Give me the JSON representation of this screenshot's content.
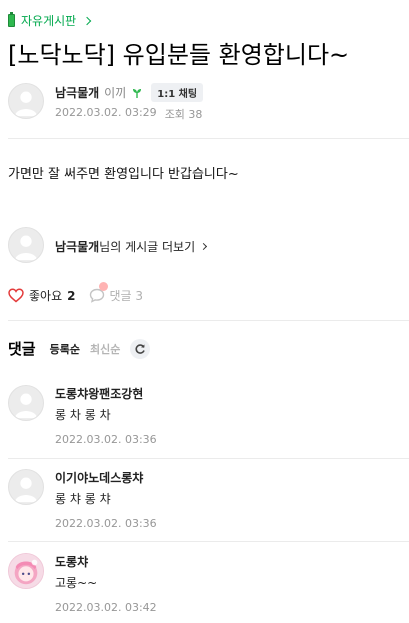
{
  "board": {
    "label": "자유게시판"
  },
  "post": {
    "title": "[노닥노닥] 유입분들 환영합니다~",
    "author": "남극물개",
    "level": "이끼",
    "chat_label": "1:1 채팅",
    "date": "2022.03.02. 03:29",
    "views": "조회 38",
    "body": "가면만 잘 써주면 환영입니다 반갑습니다~"
  },
  "more_posts": {
    "author": "남극물개",
    "suffix": "님의 게시글 더보기"
  },
  "reactions": {
    "like_label": "좋아요",
    "like_count": "2",
    "comment_label": "댓글 3"
  },
  "comments_section": {
    "title": "댓글",
    "sort_options": [
      "등록순",
      "최신순"
    ],
    "items": [
      {
        "author": "도롱챠왕팬조강현",
        "text": "롱 차 롱 차",
        "date": "2022.03.02. 03:36"
      },
      {
        "author": "이기야노데스롱챠",
        "text": "롱 챠 롱 챠",
        "date": "2022.03.02. 03:36"
      },
      {
        "author": "도롱챠",
        "text": "고롱~~",
        "date": "2022.03.02. 03:42"
      }
    ]
  },
  "colors": {
    "accent": "#03a94e",
    "like": "#e33b3b",
    "muted": "#979797"
  },
  "icons": [
    "battery-icon",
    "chevron-right-icon",
    "sprout-icon",
    "heart-icon",
    "comment-bubble-icon",
    "refresh-icon",
    "default-avatar-icon"
  ]
}
